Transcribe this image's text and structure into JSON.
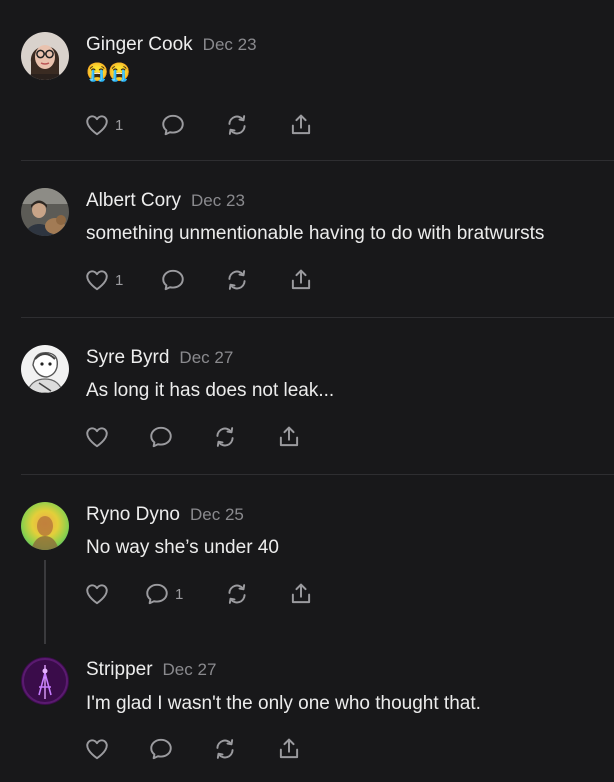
{
  "comments": [
    {
      "name": "Ginger Cook",
      "date": "Dec 23",
      "text": "😭😭",
      "like_count": "1",
      "reply_count": "",
      "avatar_icon": "woman-glasses-avatar"
    },
    {
      "name": "Albert Cory",
      "date": "Dec 23",
      "text": "something unmentionable having to do with bratwursts",
      "like_count": "1",
      "reply_count": "",
      "avatar_icon": "man-with-dog-avatar"
    },
    {
      "name": "Syre Byrd",
      "date": "Dec 27",
      "text": "As long it has does not leak...",
      "like_count": "",
      "reply_count": "",
      "avatar_icon": "bw-portrait-avatar"
    },
    {
      "name": "Ryno Dyno",
      "date": "Dec 25",
      "text": "No way she’s under 40",
      "like_count": "",
      "reply_count": "1",
      "avatar_icon": "gradient-portrait-avatar"
    },
    {
      "name": "Stripper",
      "date": "Dec 27",
      "text": "I'm glad I wasn't the only one who thought that.",
      "like_count": "",
      "reply_count": "",
      "avatar_icon": "purple-neon-avatar"
    }
  ],
  "colors": {
    "background": "#18181a",
    "text": "#ececec",
    "muted": "#8a8a8e",
    "divider": "#2e2e31"
  }
}
